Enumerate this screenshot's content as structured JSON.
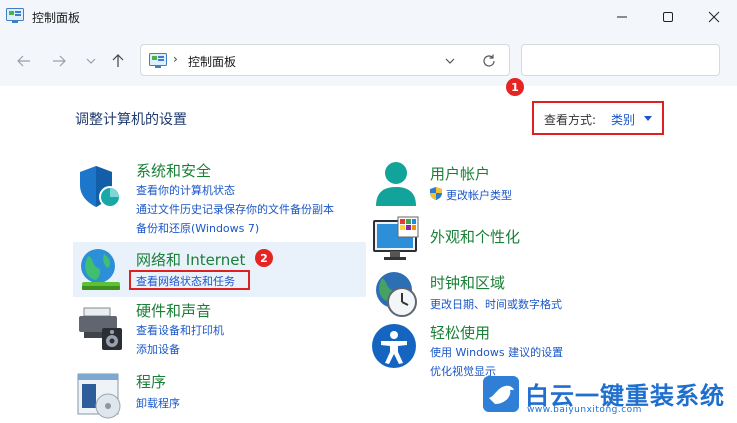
{
  "window": {
    "title": "控制面板",
    "controls": {
      "minimize": "—",
      "maximize": "☐",
      "close": "✕"
    }
  },
  "address": {
    "separator": "›",
    "path": "控制面板",
    "search_placeholder": ""
  },
  "main": {
    "heading": "调整计算机的设置",
    "view_by": {
      "label": "查看方式:",
      "value": "类别"
    }
  },
  "badges": {
    "one": "1",
    "two": "2"
  },
  "categories_left": [
    {
      "title": "系统和安全",
      "links": [
        "查看你的计算机状态",
        "通过文件历史记录保存你的文件备份副本",
        "备份和还原(Windows 7)"
      ]
    },
    {
      "title": "网络和 Internet",
      "links": [
        "查看网络状态和任务"
      ]
    },
    {
      "title": "硬件和声音",
      "links": [
        "查看设备和打印机",
        "添加设备"
      ]
    },
    {
      "title": "程序",
      "links": [
        "卸载程序"
      ]
    }
  ],
  "categories_right": [
    {
      "title": "用户帐户",
      "links": [
        "更改帐户类型"
      ]
    },
    {
      "title": "外观和个性化",
      "links": []
    },
    {
      "title": "时钟和区域",
      "links": [
        "更改日期、时间或数字格式"
      ]
    },
    {
      "title": "轻松使用",
      "links": [
        "使用 Windows 建议的设置",
        "优化视觉显示"
      ]
    }
  ],
  "watermark": {
    "brand": "白云一键重装系统",
    "url": "www.baiyunxitong.com"
  },
  "colors": {
    "title_green": "#1a7f37",
    "link_blue": "#1a56c8",
    "annotation_red": "#e02020"
  }
}
